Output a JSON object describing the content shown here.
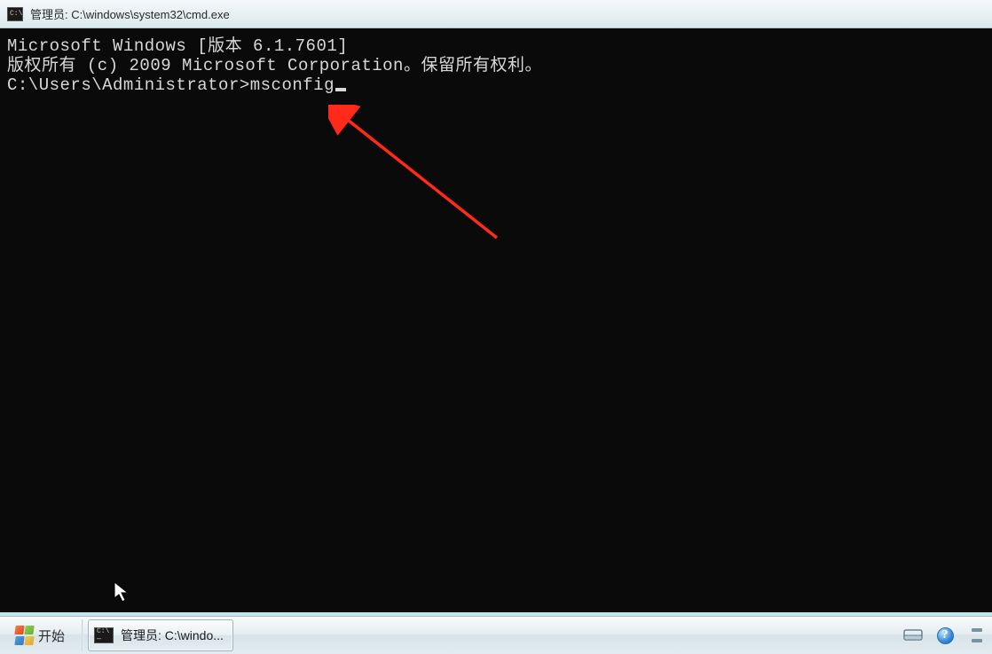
{
  "titlebar": {
    "icon_text": "C:\\",
    "title": "管理员: C:\\windows\\system32\\cmd.exe"
  },
  "terminal": {
    "line1": "Microsoft Windows [版本 6.1.7601]",
    "line2": "版权所有 (c) 2009 Microsoft Corporation。保留所有权利。",
    "blank": "",
    "prompt": "C:\\Users\\Administrator>",
    "command": "msconfig"
  },
  "taskbar": {
    "start_label": "开始",
    "task_item_icon_text": "C:\\ —",
    "task_item_label": "管理员: C:\\windo...",
    "help_glyph": "?"
  },
  "annotation": {
    "arrow_color": "#ff2a1a"
  }
}
